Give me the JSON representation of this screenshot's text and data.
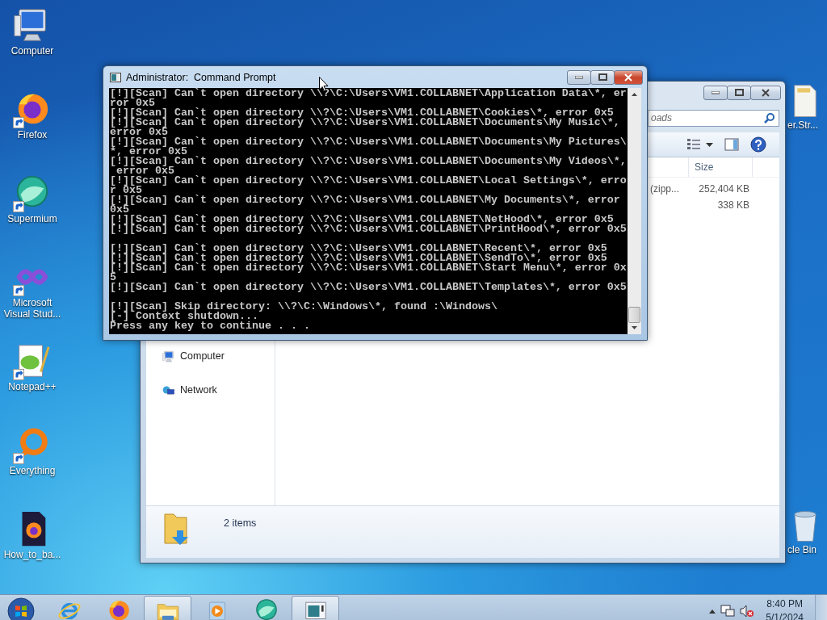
{
  "desktop_icons": [
    {
      "label": "Computer",
      "kind": "computer",
      "shortcut": false
    },
    {
      "label": "Firefox",
      "kind": "firefox",
      "shortcut": true
    },
    {
      "label": "Supermium",
      "kind": "supermium",
      "shortcut": true
    },
    {
      "label": "Microsoft Visual Stud...",
      "kind": "vs",
      "shortcut": true
    },
    {
      "label": "Notepad++",
      "kind": "notepad",
      "shortcut": true
    },
    {
      "label": "Everything",
      "kind": "everything",
      "shortcut": true
    },
    {
      "label": "How_to_ba...",
      "kind": "firefox-doc",
      "shortcut": false
    }
  ],
  "edge_icons": [
    {
      "label": "er.Str...",
      "kind": "file"
    },
    {
      "label": "cle Bin",
      "kind": "bin"
    }
  ],
  "explorer": {
    "active": false,
    "search": {
      "value": "oads"
    },
    "columns": [
      "Size"
    ],
    "rows": [
      {
        "type": "(zipp...",
        "size": "252,404 KB"
      },
      {
        "size": "338 KB"
      }
    ],
    "nav_items": [
      {
        "label": "Computer",
        "kind": "computer"
      },
      {
        "label": "Network",
        "kind": "network"
      }
    ],
    "status": "2 items"
  },
  "console": {
    "title": "Administrator:  Command Prompt",
    "active": true,
    "lines": [
      {
        "text": "[!][Scan] Can`t open directory \\\\?\\C:\\Users\\VM1.COLLABNET\\Application Data\\*, er"
      },
      {
        "text": "ror 0x5"
      },
      {
        "text": "[!][Scan] Can`t open directory \\\\?\\C:\\Users\\VM1.COLLABNET\\Cookies\\*, error 0x5"
      },
      {
        "text": "[!][Scan] Can`t open directory \\\\?\\C:\\Users\\VM1.COLLABNET\\Documents\\My Music\\*,"
      },
      {
        "text": "error 0x5"
      },
      {
        "text": "[!][Scan] Can`t open directory \\\\?\\C:\\Users\\VM1.COLLABNET\\Documents\\My Pictures\\"
      },
      {
        "text": "*, error 0x5"
      },
      {
        "text": "[!][Scan] Can`t open directory \\\\?\\C:\\Users\\VM1.COLLABNET\\Documents\\My Videos\\*,"
      },
      {
        "text": " error 0x5"
      },
      {
        "text": "[!][Scan] Can`t open directory \\\\?\\C:\\Users\\VM1.COLLABNET\\Local Settings\\*, erro"
      },
      {
        "text": "r 0x5"
      },
      {
        "text": "[!][Scan] Can`t open directory \\\\?\\C:\\Users\\VM1.COLLABNET\\My Documents\\*, error"
      },
      {
        "text": "0x5"
      },
      {
        "text": "[!][Scan] Can`t open directory \\\\?\\C:\\Users\\VM1.COLLABNET\\NetHood\\*, error 0x5"
      },
      {
        "text": "[!][Scan] Can`t open directory \\\\?\\C:\\Users\\VM1.COLLABNET\\PrintHood\\*, error 0x5"
      },
      {
        "text": "[!][Scan] Can`t open directory \\\\?\\C:\\Users\\VM1.COLLABNET\\Recent\\*, error 0x5",
        "blank_before": true
      },
      {
        "text": "[!][Scan] Can`t open directory \\\\?\\C:\\Users\\VM1.COLLABNET\\SendTo\\*, error 0x5"
      },
      {
        "text": "[!][Scan] Can`t open directory \\\\?\\C:\\Users\\VM1.COLLABNET\\Start Menu\\*, error 0x"
      },
      {
        "text": "5"
      },
      {
        "text": "[!][Scan] Can`t open directory \\\\?\\C:\\Users\\VM1.COLLABNET\\Templates\\*, error 0x5"
      },
      {
        "text": "[!][Scan] Skip directory: \\\\?\\C:\\Windows\\*, found :\\Windows\\",
        "blank_before": true
      },
      {
        "text": "[-] Context shutdown..."
      },
      {
        "text": "Press any key to continue . . ."
      }
    ]
  },
  "taskbar": {
    "apps": [
      {
        "kind": "ie",
        "running": false
      },
      {
        "kind": "firefox",
        "running": false
      },
      {
        "kind": "explorer",
        "running": true
      },
      {
        "kind": "media",
        "running": false
      },
      {
        "kind": "supermium",
        "running": false
      },
      {
        "kind": "cmd",
        "running": true
      }
    ],
    "time": "8:40 PM",
    "date": "5/1/2024"
  }
}
